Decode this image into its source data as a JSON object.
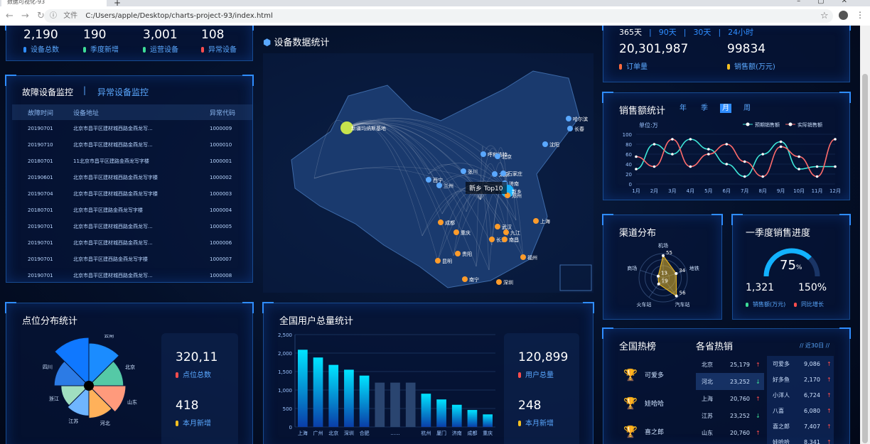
{
  "browser": {
    "tab_title": "数据可视化-93",
    "url": "C:/Users/apple/Desktop/charts-project-93/index.html",
    "url_label": "文件"
  },
  "top_stats": [
    {
      "num": "2,190",
      "label": "设备总数",
      "color": "#2f8dff"
    },
    {
      "num": "190",
      "label": "季度新增",
      "color": "#3ddc97"
    },
    {
      "num": "3,001",
      "label": "运营设备",
      "color": "#3ddc97"
    },
    {
      "num": "108",
      "label": "异常设备",
      "color": "#ff4d4d"
    }
  ],
  "fault_panel": {
    "tab_active": "故障设备监控",
    "tab_inactive": "异常设备监控",
    "col_time": "故障时间",
    "col_addr": "设备地址",
    "col_code": "异常代码",
    "rows": [
      [
        "20190701",
        "北京市昌平区建材城西路金燕龙写...",
        "1000009"
      ],
      [
        "20190710",
        "北京市昌平区建材城西路金燕龙写...",
        "1000010"
      ],
      [
        "20180701",
        "11北京市昌平区建路金燕龙写字楼",
        "1000001"
      ],
      [
        "20190601",
        "北京市昌平区建材城西路金燕龙写字楼",
        "1000002"
      ],
      [
        "20190704",
        "北京市昌平区建材城西路金燕龙写字楼",
        "1000003"
      ],
      [
        "20180701",
        "北京市昌平区建路金燕龙写字楼",
        "1000004"
      ],
      [
        "20190701",
        "北京市昌平区建材城西路金燕龙写...",
        "1000005"
      ],
      [
        "20190701",
        "北京市昌平区建材城西路金燕龙写...",
        "1000006"
      ],
      [
        "20190701",
        "北京市昌平区建西路金燕龙写字楼",
        "1000007"
      ],
      [
        "20190701",
        "北京市昌平区建材城西路金燕龙写...",
        "1000008"
      ]
    ]
  },
  "map_panel": {
    "title": "设备数据统计",
    "tooltip": "新乡 Top10",
    "cities": [
      "新疆玛纳斯基地",
      "呼和浩特",
      "北京",
      "哈尔滨",
      "长春",
      "沈阳",
      "张川",
      "太原",
      "石家庄",
      "济南",
      "西宁",
      "兰州",
      "新乡",
      "郑州",
      "上海",
      "成都",
      "武汉",
      "重庆",
      "长沙",
      "九江",
      "南昌",
      "福州",
      "贵阳",
      "昆明",
      "南宁",
      "深圳"
    ]
  },
  "orders": {
    "tabs": [
      "365天",
      "90天",
      "30天",
      "24小时"
    ],
    "orders_num": "20,301,987",
    "orders_label": "订单量",
    "sales_num": "99834",
    "sales_label": "销售额(万元)"
  },
  "sales_line": {
    "title": "销售额统计",
    "tabs": [
      "年",
      "季",
      "月",
      "周"
    ],
    "active_tab": "月",
    "unit": "单位:万",
    "legend_a": "预期销售额",
    "legend_b": "实际销售额"
  },
  "chart_data": [
    {
      "type": "line",
      "title": "销售额统计",
      "ylabel": "单位:万",
      "categories": [
        "1月",
        "2月",
        "3月",
        "4月",
        "5月",
        "6月",
        "7月",
        "8月",
        "9月",
        "10月",
        "11月",
        "12月"
      ],
      "ylim": [
        0,
        100
      ],
      "series": [
        {
          "name": "预期销售额",
          "values": [
            30,
            80,
            60,
            90,
            70,
            40,
            15,
            60,
            85,
            30,
            35,
            35
          ],
          "color": "#3ee6d8"
        },
        {
          "name": "实际销售额",
          "values": [
            55,
            35,
            90,
            35,
            60,
            80,
            45,
            15,
            75,
            55,
            15,
            90
          ],
          "color": "#ff6b6b"
        }
      ]
    },
    {
      "type": "bar",
      "title": "全国用户总量统计",
      "categories": [
        "上海",
        "广州",
        "北京",
        "深圳",
        "合肥",
        "",
        "......",
        "",
        "杭州",
        "厦门",
        "济南",
        "成都",
        "重庆"
      ],
      "ylim": [
        0,
        2500
      ],
      "values": [
        2090,
        1880,
        1680,
        1550,
        1390,
        1200,
        1200,
        1200,
        900,
        745,
        600,
        460,
        340
      ],
      "yticks": [
        "0",
        "500",
        "1,000",
        "1,500",
        "2,000",
        "2,500"
      ]
    },
    {
      "type": "pie",
      "title": "点位分布统计",
      "categories": [
        "云南",
        "北京",
        "山东",
        "河北",
        "江苏",
        "浙江",
        "四川",
        "湖北"
      ],
      "values": [
        25,
        18,
        20,
        16,
        14,
        12,
        18,
        30
      ]
    },
    {
      "type": "radar",
      "title": "渠道分布",
      "categories": [
        "机场",
        "地铁",
        "汽车站",
        "火车站",
        "商场"
      ],
      "values": [
        55,
        34,
        56,
        19,
        13
      ]
    },
    {
      "type": "gauge",
      "title": "一季度销售进度",
      "value": 75
    }
  ],
  "point_dist": {
    "title": "点位分布统计",
    "total_num": "320,11",
    "total_label": "点位总数",
    "new_num": "418",
    "new_label": "本月新增"
  },
  "users": {
    "title": "全国用户总量统计",
    "total_num": "120,899",
    "total_label": "用户总量",
    "new_num": "248",
    "new_label": "本月新增"
  },
  "channel": {
    "title": "渠道分布",
    "labels": [
      "机场",
      "地铁",
      "汽车站",
      "火车站",
      "商场"
    ],
    "vals": [
      "55",
      "34",
      "56",
      "19",
      "13"
    ]
  },
  "quarter": {
    "title": "一季度销售进度",
    "percent": "75",
    "pct_sign": "%",
    "sales": "1,321",
    "sales_label": "销售额(万元)",
    "growth": "150%",
    "growth_label": "同比增长"
  },
  "hot": {
    "title": "全国热榜",
    "sub": "各省热销",
    "recent": "// 近30日 //",
    "top": [
      {
        "name": "可爱多",
        "color": "#ff6b3d"
      },
      {
        "name": "娃哈哈",
        "color": "#48c0ff"
      },
      {
        "name": "喜之郎",
        "color": "#2f8dff"
      }
    ],
    "provinces": [
      {
        "n": "北京",
        "v": "25,179",
        "up": true
      },
      {
        "n": "河北",
        "v": "23,252",
        "up": false
      },
      {
        "n": "上海",
        "v": "20,760",
        "up": true
      },
      {
        "n": "江苏",
        "v": "23,252",
        "up": false
      },
      {
        "n": "山东",
        "v": "20,760",
        "up": true
      }
    ],
    "products": [
      {
        "n": "可爱多",
        "v": "9,086"
      },
      {
        "n": "好多鱼",
        "v": "2,170"
      },
      {
        "n": "小洋人",
        "v": "6,724"
      },
      {
        "n": "八喜",
        "v": "6,080"
      },
      {
        "n": "喜之郎",
        "v": "7,407"
      },
      {
        "n": "娃哈哈",
        "v": "8,341"
      }
    ]
  }
}
